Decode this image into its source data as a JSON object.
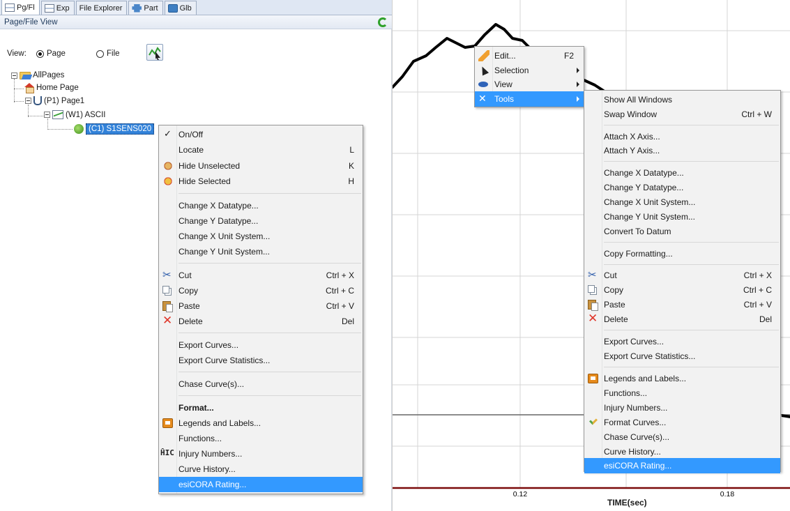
{
  "tabs": [
    {
      "label": "Pg/Fl",
      "icon": "tree-view-icon",
      "active": true
    },
    {
      "label": "Exp",
      "icon": "tree-view-icon",
      "active": false
    },
    {
      "label": "File Explorer",
      "icon": "",
      "active": false
    },
    {
      "label": "Part",
      "icon": "part-icon",
      "active": false
    },
    {
      "label": "Glb",
      "icon": "globe-icon",
      "active": false
    }
  ],
  "panel_header": {
    "title": "Page/File View"
  },
  "view_row": {
    "label": "View:",
    "page_option": "Page",
    "file_option": "File",
    "selected": "Page"
  },
  "tree": {
    "root": "AllPages",
    "home": "Home Page",
    "page": "(P1) Page1",
    "window": "(W1) ASCII",
    "curve": "(C1) S1SENS020"
  },
  "left_menu": {
    "items": [
      {
        "label": "On/Off",
        "shortcut": "",
        "icon": "checkmark-icon"
      },
      {
        "label": "Locate",
        "shortcut": "L",
        "icon": ""
      },
      {
        "label": "Hide Unselected",
        "shortcut": "K",
        "icon": "hide-unselected-icon"
      },
      {
        "label": "Hide Selected",
        "shortcut": "H",
        "icon": "hide-selected-icon"
      },
      {
        "label": "Change X Datatype...",
        "shortcut": "",
        "icon": ""
      },
      {
        "label": "Change Y Datatype...",
        "shortcut": "",
        "icon": ""
      },
      {
        "label": "Change X Unit System...",
        "shortcut": "",
        "icon": ""
      },
      {
        "label": "Change Y Unit System...",
        "shortcut": "",
        "icon": ""
      },
      {
        "label": "Cut",
        "shortcut": "Ctrl + X",
        "icon": "scissors-icon"
      },
      {
        "label": "Copy",
        "shortcut": "Ctrl + C",
        "icon": "copy-icon"
      },
      {
        "label": "Paste",
        "shortcut": "Ctrl + V",
        "icon": "paste-icon"
      },
      {
        "label": "Delete",
        "shortcut": "Del",
        "icon": "delete-icon"
      },
      {
        "label": "Export Curves...",
        "shortcut": "",
        "icon": ""
      },
      {
        "label": "Export Curve Statistics...",
        "shortcut": "",
        "icon": ""
      },
      {
        "label": "Chase Curve(s)...",
        "shortcut": "",
        "icon": ""
      },
      {
        "label": "Format...",
        "shortcut": "",
        "icon": ""
      },
      {
        "label": "Legends and Labels...",
        "shortcut": "",
        "icon": "legends-icon"
      },
      {
        "label": "Functions...",
        "shortcut": "",
        "icon": ""
      },
      {
        "label": "Injury Numbers...",
        "shortcut": "",
        "icon": "injury-icon"
      },
      {
        "label": "Curve History...",
        "shortcut": "",
        "icon": ""
      },
      {
        "label": "esiCORA Rating...",
        "shortcut": "",
        "icon": ""
      }
    ]
  },
  "chart_menu": {
    "items": [
      {
        "label": "Edit...",
        "shortcut": "F2",
        "icon": "pencil-icon"
      },
      {
        "label": "Selection",
        "shortcut": "",
        "icon": "pointer-icon"
      },
      {
        "label": "View",
        "shortcut": "",
        "icon": "eye-icon"
      },
      {
        "label": "Tools",
        "shortcut": "",
        "icon": "tools-icon"
      }
    ]
  },
  "tools_submenu": {
    "items": [
      {
        "label": "Show All Windows",
        "shortcut": ""
      },
      {
        "label": "Swap Window",
        "shortcut": "Ctrl + W"
      },
      {
        "label": "Attach X Axis...",
        "shortcut": ""
      },
      {
        "label": "Attach Y Axis...",
        "shortcut": ""
      },
      {
        "label": "Change X Datatype...",
        "shortcut": ""
      },
      {
        "label": "Change Y Datatype...",
        "shortcut": ""
      },
      {
        "label": "Change X Unit System...",
        "shortcut": ""
      },
      {
        "label": "Change Y Unit System...",
        "shortcut": ""
      },
      {
        "label": "Convert To Datum",
        "shortcut": ""
      },
      {
        "label": "Copy Formatting...",
        "shortcut": ""
      },
      {
        "label": "Cut",
        "shortcut": "Ctrl + X"
      },
      {
        "label": "Copy",
        "shortcut": "Ctrl + C"
      },
      {
        "label": "Paste",
        "shortcut": "Ctrl + V"
      },
      {
        "label": "Delete",
        "shortcut": "Del"
      },
      {
        "label": "Export Curves...",
        "shortcut": ""
      },
      {
        "label": "Export Curve Statistics...",
        "shortcut": ""
      },
      {
        "label": "Legends and Labels...",
        "shortcut": ""
      },
      {
        "label": "Functions...",
        "shortcut": ""
      },
      {
        "label": "Injury Numbers...",
        "shortcut": ""
      },
      {
        "label": "Format Curves...",
        "shortcut": ""
      },
      {
        "label": "Chase Curve(s)...",
        "shortcut": ""
      },
      {
        "label": "Curve History...",
        "shortcut": ""
      },
      {
        "label": "esiCORA Rating...",
        "shortcut": ""
      }
    ]
  },
  "chart": {
    "x_ticks": [
      "0.12",
      "0.18"
    ],
    "x_label": "TIME(sec)"
  },
  "colors": {
    "highlight": "#3399ff",
    "tree_select": "#3282d9",
    "curve": "#000000",
    "datum": "#7a0a0a"
  }
}
